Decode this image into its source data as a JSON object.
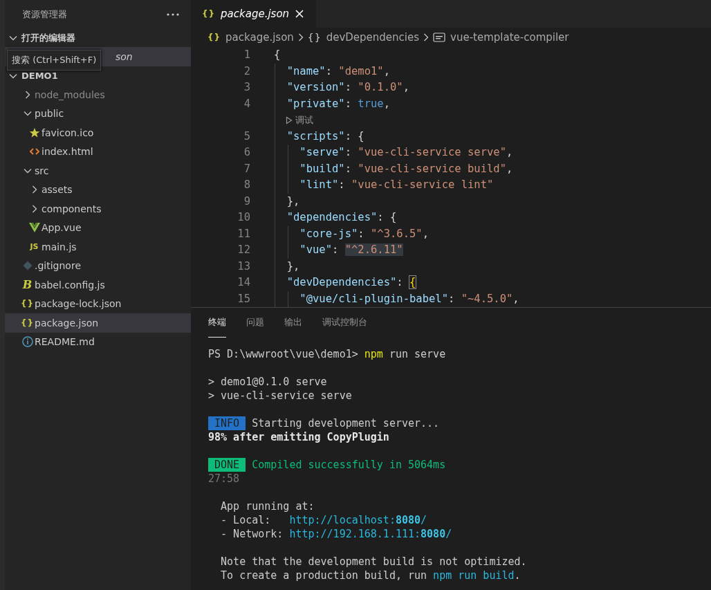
{
  "sidebar": {
    "title": "资源管理器",
    "sections": [
      {
        "title": "打开的编辑器",
        "expanded": true,
        "items": [
          {
            "label": "son",
            "selected": true
          }
        ]
      },
      {
        "title": "DEMO1",
        "expanded": true
      }
    ],
    "tooltip": "搜索 (Ctrl+Shift+F)",
    "tree": [
      {
        "label": "node_modules",
        "kind": "folder",
        "expanded": false,
        "ignored": true,
        "selected": false
      },
      {
        "label": "public",
        "kind": "folder",
        "expanded": true,
        "ignored": false,
        "selected": false,
        "children": [
          {
            "label": "favicon.ico",
            "kind": "star",
            "ignored": false,
            "selected": false
          },
          {
            "label": "index.html",
            "kind": "html",
            "ignored": false,
            "selected": false
          }
        ]
      },
      {
        "label": "src",
        "kind": "folder",
        "expanded": true,
        "ignored": false,
        "selected": false,
        "children": [
          {
            "label": "assets",
            "kind": "folder",
            "expanded": false,
            "ignored": false,
            "selected": false
          },
          {
            "label": "components",
            "kind": "folder",
            "expanded": false,
            "ignored": false,
            "selected": false
          },
          {
            "label": "App.vue",
            "kind": "vue",
            "ignored": false,
            "selected": false
          },
          {
            "label": "main.js",
            "kind": "glyph",
            "glyph": "JS",
            "ignored": false,
            "selected": false
          }
        ]
      },
      {
        "label": ".gitignore",
        "kind": "git",
        "ignored": false,
        "selected": false
      },
      {
        "label": "babel.config.js",
        "kind": "glyph",
        "glyph": "B",
        "ignored": false,
        "selected": false
      },
      {
        "label": "package-lock.json",
        "kind": "glyph",
        "glyph": "{}",
        "ignored": false,
        "selected": false
      },
      {
        "label": "package.json",
        "kind": "glyph",
        "glyph": "{}",
        "ignored": false,
        "selected": true
      },
      {
        "label": "README.md",
        "kind": "info",
        "ignored": false,
        "selected": false
      }
    ]
  },
  "editor": {
    "tabs": [
      {
        "glyph": "{}",
        "label": "package.json",
        "selected": true
      }
    ],
    "breadcrumb": [
      {
        "glyph": "{}",
        "label": "package.json",
        "kind": "file"
      },
      {
        "glyph": "{}",
        "label": "devDependencies",
        "kind": "object"
      },
      {
        "label": "vue-template-compiler",
        "kind": "string"
      }
    ],
    "lines": [
      {
        "kind": "code",
        "number": "1",
        "tokens": [
          {
            "t": "{",
            "kind": "punct"
          }
        ]
      },
      {
        "kind": "code",
        "number": "2",
        "tokens": [
          {
            "t": "  \"name\"",
            "kind": "key"
          },
          {
            "t": ": ",
            "kind": "punct"
          },
          {
            "t": "\"demo1\"",
            "kind": "string"
          },
          {
            "t": ",",
            "kind": "punct"
          }
        ]
      },
      {
        "kind": "code",
        "number": "3",
        "tokens": [
          {
            "t": "  \"version\"",
            "kind": "key"
          },
          {
            "t": ": ",
            "kind": "punct"
          },
          {
            "t": "\"0.1.0\"",
            "kind": "string"
          },
          {
            "t": ",",
            "kind": "punct"
          }
        ]
      },
      {
        "kind": "code",
        "number": "4",
        "tokens": [
          {
            "t": "  \"private\"",
            "kind": "key"
          },
          {
            "t": ": ",
            "kind": "punct"
          },
          {
            "t": "true",
            "kind": "bool"
          },
          {
            "t": ",",
            "kind": "punct"
          }
        ]
      },
      {
        "kind": "codelens",
        "text": "调试"
      },
      {
        "kind": "code",
        "number": "5",
        "tokens": [
          {
            "t": "  \"scripts\"",
            "kind": "key"
          },
          {
            "t": ": {",
            "kind": "punct"
          }
        ]
      },
      {
        "kind": "code",
        "number": "6",
        "tokens": [
          {
            "t": "    \"serve\"",
            "kind": "key"
          },
          {
            "t": ": ",
            "kind": "punct"
          },
          {
            "t": "\"vue-cli-service serve\"",
            "kind": "string"
          },
          {
            "t": ",",
            "kind": "punct"
          }
        ]
      },
      {
        "kind": "code",
        "number": "7",
        "tokens": [
          {
            "t": "    \"build\"",
            "kind": "key"
          },
          {
            "t": ": ",
            "kind": "punct"
          },
          {
            "t": "\"vue-cli-service build\"",
            "kind": "string"
          },
          {
            "t": ",",
            "kind": "punct"
          }
        ]
      },
      {
        "kind": "code",
        "number": "8",
        "tokens": [
          {
            "t": "    \"lint\"",
            "kind": "key"
          },
          {
            "t": ": ",
            "kind": "punct"
          },
          {
            "t": "\"vue-cli-service lint\"",
            "kind": "string"
          }
        ]
      },
      {
        "kind": "code",
        "number": "9",
        "tokens": [
          {
            "t": "  },",
            "kind": "punct"
          }
        ]
      },
      {
        "kind": "code",
        "number": "10",
        "tokens": [
          {
            "t": "  \"dependencies\"",
            "kind": "key"
          },
          {
            "t": ": {",
            "kind": "punct"
          }
        ]
      },
      {
        "kind": "code",
        "number": "11",
        "tokens": [
          {
            "t": "    \"core-js\"",
            "kind": "key"
          },
          {
            "t": ": ",
            "kind": "punct"
          },
          {
            "t": "\"^3.6.5\"",
            "kind": "string"
          },
          {
            "t": ",",
            "kind": "punct"
          }
        ]
      },
      {
        "kind": "code",
        "number": "12",
        "tokens": [
          {
            "t": "    \"vue\"",
            "kind": "key"
          },
          {
            "t": ": ",
            "kind": "punct"
          },
          {
            "t": "\"^2.6.11\"",
            "kind": "string-highlighted"
          }
        ]
      },
      {
        "kind": "code",
        "number": "13",
        "tokens": [
          {
            "t": "  },",
            "kind": "punct"
          }
        ]
      },
      {
        "kind": "code",
        "number": "14",
        "tokens": [
          {
            "t": "  \"devDependencies\"",
            "kind": "key"
          },
          {
            "t": ": ",
            "kind": "punct"
          },
          {
            "t": "{",
            "kind": "bracket-match"
          }
        ]
      },
      {
        "kind": "code",
        "number": "15",
        "tokens": [
          {
            "t": "    \"@vue/cli-plugin-babel\"",
            "kind": "key"
          },
          {
            "t": ": ",
            "kind": "punct"
          },
          {
            "t": "\"~4.5.0\"",
            "kind": "string"
          },
          {
            "t": ",",
            "kind": "punct"
          }
        ]
      }
    ]
  },
  "panel": {
    "tabs": [
      {
        "label": "终端",
        "selected": true
      },
      {
        "label": "问题",
        "selected": false
      },
      {
        "label": "输出",
        "selected": false
      },
      {
        "label": "调试控制台",
        "selected": false
      }
    ],
    "terminal": [
      {
        "lines": [
          {
            "segments": [
              {
                "t": "PS D:\\wwwroot\\vue\\demo1> ",
                "kind": "plain"
              },
              {
                "t": "npm",
                "kind": "command"
              },
              {
                "t": " run serve",
                "kind": "plain"
              }
            ]
          }
        ]
      },
      {
        "lines": [
          {
            "segments": [
              {
                "t": "> demo1@0.1.0 serve",
                "kind": "plain"
              }
            ]
          },
          {
            "segments": [
              {
                "t": "> vue-cli-service serve",
                "kind": "plain"
              }
            ]
          }
        ]
      },
      {
        "lines": [
          {
            "segments": [
              {
                "t": " INFO ",
                "kind": "info-badge"
              },
              {
                "t": " Starting development server...",
                "kind": "plain"
              }
            ]
          },
          {
            "segments": [
              {
                "t": "98% after emitting CopyPlugin",
                "kind": "bold"
              }
            ]
          }
        ]
      },
      {
        "lines": [
          {
            "segments": [
              {
                "t": " DONE ",
                "kind": "done-badge"
              },
              {
                "t": " Compiled successfully in 5064ms",
                "kind": "success"
              }
            ]
          },
          {
            "segments": [
              {
                "t": "27:58",
                "kind": "dim"
              }
            ]
          }
        ]
      },
      {
        "lines": [
          {
            "segments": [
              {
                "t": "  App running at:",
                "kind": "plain"
              }
            ]
          },
          {
            "segments": [
              {
                "t": "  - Local:   ",
                "kind": "plain"
              },
              {
                "t": "http://localhost:**8080**/",
                "kind": "link"
              }
            ]
          },
          {
            "segments": [
              {
                "t": "  - Network: ",
                "kind": "plain"
              },
              {
                "t": "http://192.168.1.111:**8080**/",
                "kind": "link"
              }
            ]
          }
        ]
      },
      {
        "lines": [
          {
            "segments": [
              {
                "t": "  Note that the development build is not optimized.",
                "kind": "plain"
              }
            ]
          },
          {
            "segments": [
              {
                "t": "  To create a production build, run ",
                "kind": "plain"
              },
              {
                "t": "npm run build",
                "kind": "link"
              },
              {
                "t": ".",
                "kind": "plain"
              }
            ]
          }
        ]
      }
    ]
  }
}
